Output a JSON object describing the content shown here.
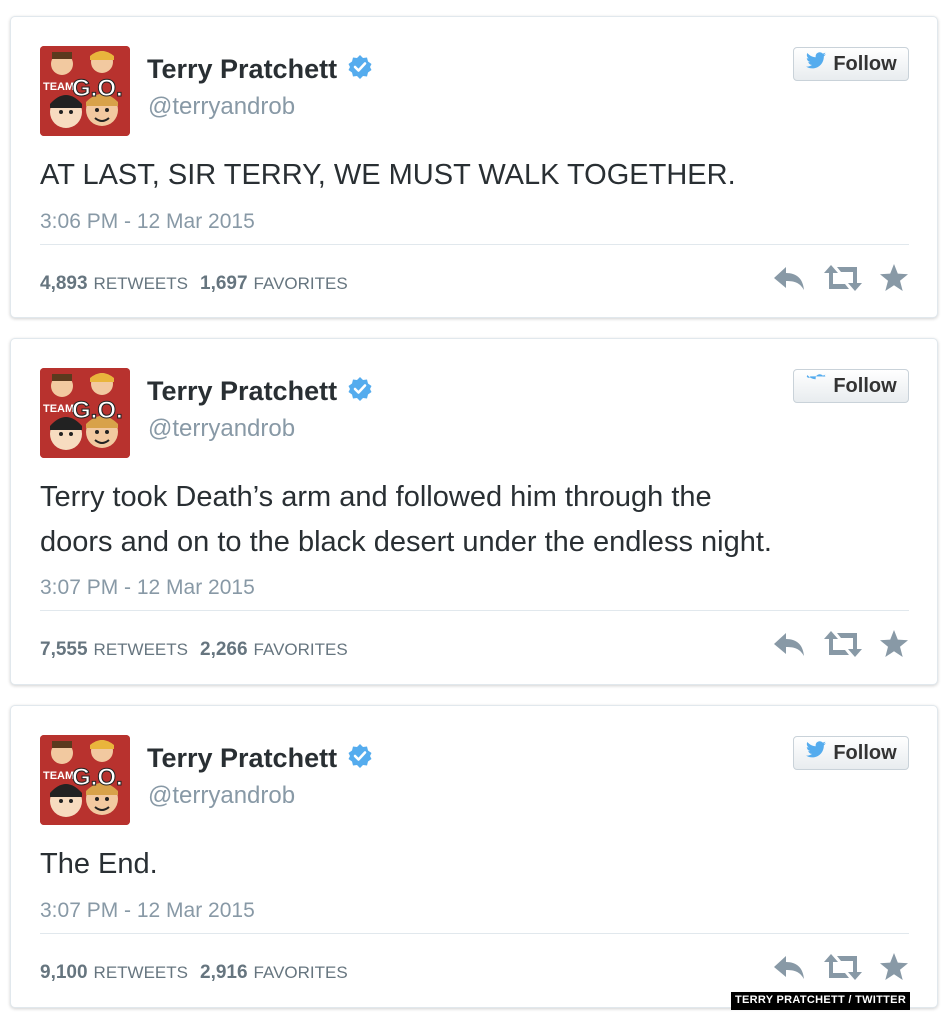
{
  "tweets": [
    {
      "name": "Terry Pratchett",
      "handle": "@terryandrob",
      "follow_label": "Follow",
      "text_lines": [
        "AT LAST, SIR TERRY, WE MUST WALK TOGETHER."
      ],
      "timestamp": "3:06 PM - 12 Mar 2015",
      "retweets": "4,893",
      "retweets_label": "RETWEETS",
      "favorites": "1,697",
      "favorites_label": "FAVORITES"
    },
    {
      "name": "Terry Pratchett",
      "handle": "@terryandrob",
      "follow_label": "Follow",
      "text_lines": [
        "Terry took Death’s arm and followed him through the",
        "doors and on to the black desert under the endless night."
      ],
      "timestamp": "3:07 PM - 12 Mar 2015",
      "retweets": "7,555",
      "retweets_label": "RETWEETS",
      "favorites": "2,266",
      "favorites_label": "FAVORITES"
    },
    {
      "name": "Terry Pratchett",
      "handle": "@terryandrob",
      "follow_label": "Follow",
      "text_lines": [
        "The End."
      ],
      "timestamp": "3:07 PM - 12 Mar 2015",
      "retweets": "9,100",
      "retweets_label": "RETWEETS",
      "favorites": "2,916",
      "favorites_label": "FAVORITES"
    }
  ],
  "avatar_text": {
    "team": "TEAM",
    "go": "G.O."
  },
  "credit": "TERRY PRATCHETT / TWITTER",
  "icons": {
    "verified": "verified-badge-icon",
    "follow": "twitter-bird-icon",
    "reply": "reply-icon",
    "retweet": "retweet-icon",
    "favorite": "star-icon"
  },
  "colors": {
    "verified_blue": "#55acee",
    "bird_blue": "#55acee",
    "action_gray": "#8899a6",
    "text_dark": "#292f33",
    "muted": "#8899a6"
  }
}
